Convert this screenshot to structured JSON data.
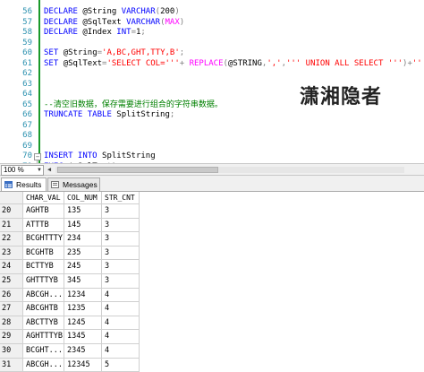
{
  "editor": {
    "lines": [
      {
        "n": "",
        "parts": []
      },
      {
        "n": "56",
        "parts": [
          [
            "kw",
            "DECLARE "
          ],
          [
            "plain",
            "@String "
          ],
          [
            "kw",
            "VARCHAR"
          ],
          [
            "gray",
            "("
          ],
          [
            "plain",
            "200"
          ],
          [
            "gray",
            ")"
          ]
        ]
      },
      {
        "n": "57",
        "parts": [
          [
            "kw",
            "DECLARE "
          ],
          [
            "plain",
            "@SqlText "
          ],
          [
            "kw",
            "VARCHAR"
          ],
          [
            "gray",
            "("
          ],
          [
            "fn",
            "MAX"
          ],
          [
            "gray",
            ")"
          ]
        ]
      },
      {
        "n": "58",
        "parts": [
          [
            "kw",
            "DECLARE "
          ],
          [
            "plain",
            "@Index "
          ],
          [
            "kw",
            "INT"
          ],
          [
            "gray",
            "="
          ],
          [
            "plain",
            "1"
          ],
          [
            "gray",
            ";"
          ]
        ]
      },
      {
        "n": "59",
        "parts": []
      },
      {
        "n": "60",
        "parts": [
          [
            "kw",
            "SET "
          ],
          [
            "plain",
            "@String"
          ],
          [
            "gray",
            "="
          ],
          [
            "str",
            "'A,BC,GHT,TTY,B'"
          ],
          [
            "gray",
            ";"
          ]
        ]
      },
      {
        "n": "61",
        "parts": [
          [
            "kw",
            "SET "
          ],
          [
            "plain",
            "@SqlText"
          ],
          [
            "gray",
            "="
          ],
          [
            "str",
            "'SELECT COL='''"
          ],
          [
            "gray",
            "+ "
          ],
          [
            "fn",
            "REPLACE"
          ],
          [
            "gray",
            "("
          ],
          [
            "plain",
            "@STRING"
          ],
          [
            "gray",
            ","
          ],
          [
            "str",
            "','"
          ],
          [
            "gray",
            ","
          ],
          [
            "str",
            "''' UNION ALL SELECT '''"
          ],
          [
            "gray",
            ")+"
          ],
          [
            "str",
            "''''"
          ]
        ]
      },
      {
        "n": "62",
        "parts": []
      },
      {
        "n": "63",
        "parts": []
      },
      {
        "n": "64",
        "parts": []
      },
      {
        "n": "65",
        "parts": [
          [
            "cmt",
            "--清空旧数据，保存需要进行组合的字符串数据。"
          ]
        ]
      },
      {
        "n": "66",
        "parts": [
          [
            "kw",
            "TRUNCATE TABLE "
          ],
          [
            "plain",
            "SplitString"
          ],
          [
            "gray",
            ";"
          ]
        ]
      },
      {
        "n": "67",
        "parts": []
      },
      {
        "n": "68",
        "parts": []
      },
      {
        "n": "69",
        "parts": []
      },
      {
        "n": "70",
        "parts": [
          [
            "kw",
            "INSERT INTO "
          ],
          [
            "plain",
            "SplitString"
          ]
        ]
      },
      {
        "n": "71",
        "parts": [
          [
            "kw",
            "EXEC "
          ],
          [
            "gray",
            "("
          ],
          [
            "plain",
            "@SqlText"
          ],
          [
            "gray",
            ")"
          ]
        ]
      },
      {
        "n": "72",
        "parts": []
      },
      {
        "n": "73",
        "parts": []
      }
    ],
    "watermark": "潇湘隐者"
  },
  "zoom": {
    "value": "100 %"
  },
  "tabs": {
    "results": "Results",
    "messages": "Messages"
  },
  "grid": {
    "columns": [
      "CHAR_VAL",
      "COL_NUM",
      "STR_CNT"
    ],
    "rows": [
      {
        "n": "20",
        "cells": [
          "AGHTB",
          "135",
          "3"
        ]
      },
      {
        "n": "21",
        "cells": [
          "ATTTB",
          "145",
          "3"
        ]
      },
      {
        "n": "22",
        "cells": [
          "BCGHTTTY",
          "234",
          "3"
        ]
      },
      {
        "n": "23",
        "cells": [
          "BCGHTB",
          "235",
          "3"
        ]
      },
      {
        "n": "24",
        "cells": [
          "BCTTYB",
          "245",
          "3"
        ]
      },
      {
        "n": "25",
        "cells": [
          "GHTTTYB",
          "345",
          "3"
        ]
      },
      {
        "n": "26",
        "cells": [
          "ABCGH...",
          "1234",
          "4"
        ]
      },
      {
        "n": "27",
        "cells": [
          "ABCGHTB",
          "1235",
          "4"
        ]
      },
      {
        "n": "28",
        "cells": [
          "ABCTTYB",
          "1245",
          "4"
        ]
      },
      {
        "n": "29",
        "cells": [
          "AGHTTTYB",
          "1345",
          "4"
        ]
      },
      {
        "n": "30",
        "cells": [
          "BCGHT...",
          "2345",
          "4"
        ]
      },
      {
        "n": "31",
        "cells": [
          "ABCGH...",
          "12345",
          "5"
        ]
      }
    ]
  },
  "colors": {
    "keyword": "#0000ff",
    "string": "#ff0000",
    "function": "#ff00ff",
    "comment": "#008000",
    "linenum": "#2b91af"
  }
}
